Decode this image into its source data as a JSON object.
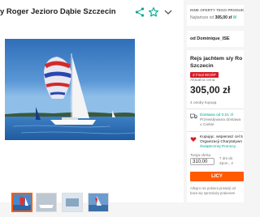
{
  "listing": {
    "title": "y Roger Jezioro Dąbie Szczecin"
  },
  "toolbar": {
    "share_icon": "share-icon",
    "favorite_icon": "star-icon",
    "more_icon": "chevron-down-icon"
  },
  "other_offers": {
    "heading": "INNE OFERTY TEGO PRODUK",
    "lowest_label": "Najtańsze od",
    "lowest_price": "305,00 zł",
    "delivery_prefix": "W"
  },
  "seller": {
    "prefix": "od",
    "name": "Dominique_ISE"
  },
  "offer": {
    "title_line1": "Rejs jachtem s/y Ro",
    "title_line2": "Szczecin",
    "badge": "Z  Final WOŚP",
    "current_price_label": "Aktualna cena",
    "price": "305,00 zł",
    "people_count": "4 osoby kupują"
  },
  "delivery": {
    "line1": "Dostawa od 0,01 zł",
    "line2": "Przewidywana dostawa",
    "line3": "u Ciebie"
  },
  "charity": {
    "line1": "Kupując, wspierasz cel 5",
    "line2": "Organizacji Charytatywn",
    "line3": "Świątecznej Pomocy"
  },
  "quantity": {
    "label": "Twoja oferta",
    "value": "310,00",
    "note_line1": "7 dni do",
    "note_line2": "Zpon., 3"
  },
  "buy": {
    "label": "LICY"
  },
  "footer": {
    "line1": "Allegro nie pobiera prowizji od",
    "line2": "baza się sprzedaży prakosem"
  },
  "gallery": {
    "thumbnail_count": 4,
    "active_index": 0
  }
}
